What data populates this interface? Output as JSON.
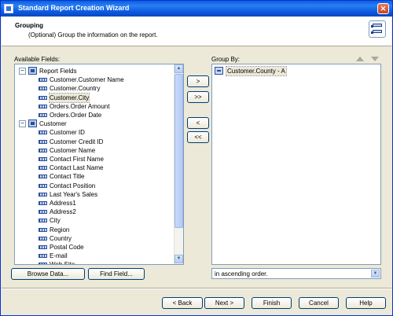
{
  "window": {
    "title": "Standard Report Creation Wizard"
  },
  "header": {
    "title": "Grouping",
    "subtitle": "(Optional) Group the information on the report."
  },
  "available": {
    "label": "Available Fields:",
    "tree": [
      {
        "text": "Report Fields",
        "type": "folder",
        "expander": "−"
      },
      {
        "text": "Customer.Customer Name",
        "type": "field"
      },
      {
        "text": "Customer.Country",
        "type": "field"
      },
      {
        "text": "Customer.City",
        "type": "field",
        "selected": true
      },
      {
        "text": "Orders.Order Amount",
        "type": "field"
      },
      {
        "text": "Orders.Order Date",
        "type": "field"
      },
      {
        "text": "Customer",
        "type": "folder",
        "expander": "−"
      },
      {
        "text": "Customer ID",
        "type": "field"
      },
      {
        "text": "Customer Credit ID",
        "type": "field"
      },
      {
        "text": "Customer Name",
        "type": "field"
      },
      {
        "text": "Contact First Name",
        "type": "field"
      },
      {
        "text": "Contact Last Name",
        "type": "field"
      },
      {
        "text": "Contact Title",
        "type": "field"
      },
      {
        "text": "Contact Position",
        "type": "field"
      },
      {
        "text": "Last Year's Sales",
        "type": "field"
      },
      {
        "text": "Address1",
        "type": "field"
      },
      {
        "text": "Address2",
        "type": "field"
      },
      {
        "text": "City",
        "type": "field"
      },
      {
        "text": "Region",
        "type": "field"
      },
      {
        "text": "Country",
        "type": "field"
      },
      {
        "text": "Postal Code",
        "type": "field"
      },
      {
        "text": "E-mail",
        "type": "field"
      },
      {
        "text": "Web Site",
        "type": "field"
      }
    ],
    "browse_label": "Browse Data...",
    "find_label": "Find Field..."
  },
  "transfer": {
    "add": ">",
    "add_all": ">>",
    "remove": "<",
    "remove_all": "<<"
  },
  "group_by": {
    "label": "Group By:",
    "items": [
      {
        "text": "Customer.County - A"
      }
    ],
    "sort_value": "in ascending order."
  },
  "footer": {
    "back": "< Back",
    "next": "Next >",
    "finish": "Finish",
    "cancel": "Cancel",
    "help": "Help"
  }
}
